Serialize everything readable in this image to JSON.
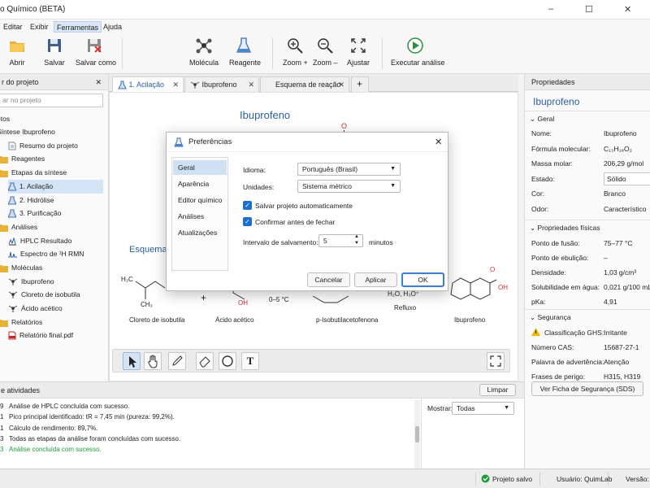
{
  "window": {
    "title": "o Químico (BETA)",
    "controls": [
      "–",
      "☐",
      "✕"
    ]
  },
  "menu": [
    "Editar",
    "Exibir",
    "Ferramentas",
    "Ajuda"
  ],
  "menu_active": "Ferramentas",
  "toolbar": {
    "open": "Abrir",
    "save": "Salvar",
    "save_as": "Salvar como",
    "molecule": "Molécula",
    "reagent": "Reagente",
    "zoom_in": "Zoom +",
    "zoom_out": "Zoom –",
    "fit": "Ajustar",
    "run": "Executar análise"
  },
  "left": {
    "title": "r do projeto",
    "search_placeholder": "ar no projeto",
    "tree": [
      {
        "label": "etos",
        "level": 0,
        "icon": "none"
      },
      {
        "label": "Síntese Ibuprofeno",
        "level": 0,
        "icon": "none"
      },
      {
        "label": "Resumo do projeto",
        "level": 1,
        "icon": "doc"
      },
      {
        "label": "Reagentes",
        "level": 1,
        "icon": "folder"
      },
      {
        "label": "Etapas da síntese",
        "level": 1,
        "icon": "folder"
      },
      {
        "label": "1. Acilação",
        "level": 2,
        "icon": "flask",
        "selected": true
      },
      {
        "label": "2. Hidrólise",
        "level": 2,
        "icon": "flask"
      },
      {
        "label": "3. Purificação",
        "level": 2,
        "icon": "flask"
      },
      {
        "label": "Análises",
        "level": 1,
        "icon": "folder"
      },
      {
        "label": "HPLC Resultado",
        "level": 2,
        "icon": "chart"
      },
      {
        "label": "Espectro de ¹H RMN",
        "level": 2,
        "icon": "wave"
      },
      {
        "label": "Moléculas",
        "level": 1,
        "icon": "folder"
      },
      {
        "label": "Ibuprofeno",
        "level": 2,
        "icon": "mol"
      },
      {
        "label": "Cloreto de isobutila",
        "level": 2,
        "icon": "mol"
      },
      {
        "label": "Ácido acético",
        "level": 2,
        "icon": "mol"
      },
      {
        "label": "Relatórios",
        "level": 1,
        "icon": "folder"
      },
      {
        "label": "Relatório final.pdf",
        "level": 2,
        "icon": "pdf"
      }
    ]
  },
  "tabs": [
    {
      "label": "1. Acilação",
      "active": true
    },
    {
      "label": "Ibuprofeno",
      "active": false
    },
    {
      "label": "Esquema de reação",
      "active": false
    }
  ],
  "canvas": {
    "mol_title": "Ibuprofeno",
    "scheme_title": "Esquema",
    "o_label": "O",
    "plus": "+",
    "h3c": "H₃C",
    "ch3": "CH₃",
    "oh": "OH",
    "cond1": "0–5 °C",
    "cond2": "H₂O, H₃O⁺",
    "reflux": "Refluxo",
    "names": [
      "Cloreto de isobutila",
      "Ácido acético",
      "p-Isobutilacetofenona",
      "Ibuprofeno"
    ]
  },
  "dialog": {
    "title": "Preferências",
    "side": [
      "Geral",
      "Aparência",
      "Editor químico",
      "Análises",
      "Atualizações"
    ],
    "side_selected": "Geral",
    "language_label": "Idioma:",
    "language_value": "Português (Brasil)",
    "units_label": "Unidades:",
    "units_value": "Sistema métrico",
    "autosave_label": "Salvar projeto automaticamente",
    "confirm_label": "Confirmar antes de fechar",
    "autosave_checked": true,
    "confirm_checked": true,
    "interval_label": "Intervalo de salvamento:",
    "interval_value": "5",
    "interval_unit": "minutos",
    "cancel": "Cancelar",
    "apply": "Aplicar",
    "ok": "OK"
  },
  "right": {
    "header": "Propriedades",
    "name": "Ibuprofeno",
    "general_title": "Geral",
    "general": [
      {
        "k": "Nome:",
        "v": "Ibuprofeno"
      },
      {
        "k": "Fórmula molecular:",
        "v": "C₁₃H₁₈O₂"
      },
      {
        "k": "Massa molar:",
        "v": "206,29 g/mol"
      },
      {
        "k": "Estado:",
        "v": "Sólido"
      },
      {
        "k": "Cor:",
        "v": "Branco"
      },
      {
        "k": "Odor:",
        "v": "Característico"
      }
    ],
    "physical_title": "Propriedades físicas",
    "physical": [
      {
        "k": "Ponto de fusão:",
        "v": "75–77 °C"
      },
      {
        "k": "Ponto de ebulição:",
        "v": "–"
      },
      {
        "k": "Densidade:",
        "v": "1,03 g/cm³"
      },
      {
        "k": "Solubilidade em água:",
        "v": "0,021 g/100 mL ("
      },
      {
        "k": "pKa:",
        "v": "4,91"
      }
    ],
    "safety_title": "Segurança",
    "safety": [
      {
        "k": "Classificação GHS:",
        "v": "Irritante"
      },
      {
        "k": "Número CAS:",
        "v": "15687-27-1"
      },
      {
        "k": "Palavra de advertência:",
        "v": "Atenção"
      },
      {
        "k": "Frases de perigo:",
        "v": "H315, H319"
      }
    ],
    "sds_button": "Ver Ficha de Segurança (SDS)"
  },
  "activity": {
    "title": "e atividades",
    "clear": "Limpar",
    "show_label": "Mostrar:",
    "show_value": "Todas",
    "logs": [
      {
        "n": "9",
        "text": "Análise de HPLC concluída com sucesso.",
        "ok": false
      },
      {
        "n": "1",
        "text": "Pico principal identificado: tR = 7,45 min (pureza: 99,2%).",
        "ok": false
      },
      {
        "n": "1",
        "text": "Cálculo de rendimento: 89,7%.",
        "ok": false
      },
      {
        "n": "3",
        "text": "Todas as etapas da análise foram concluídas com sucesso.",
        "ok": false
      },
      {
        "n": "3",
        "text": "Análise concluída com sucesso.",
        "ok": true
      }
    ]
  },
  "status": {
    "saved": "Projeto salvo",
    "user": "Usuário: QuimLab",
    "version": "Versão: 0"
  },
  "colors": {
    "accent": "#1a6fd1",
    "success": "#1f9a3a",
    "atom_o": "#d32f2f",
    "title_blue": "#2b5f9e"
  }
}
